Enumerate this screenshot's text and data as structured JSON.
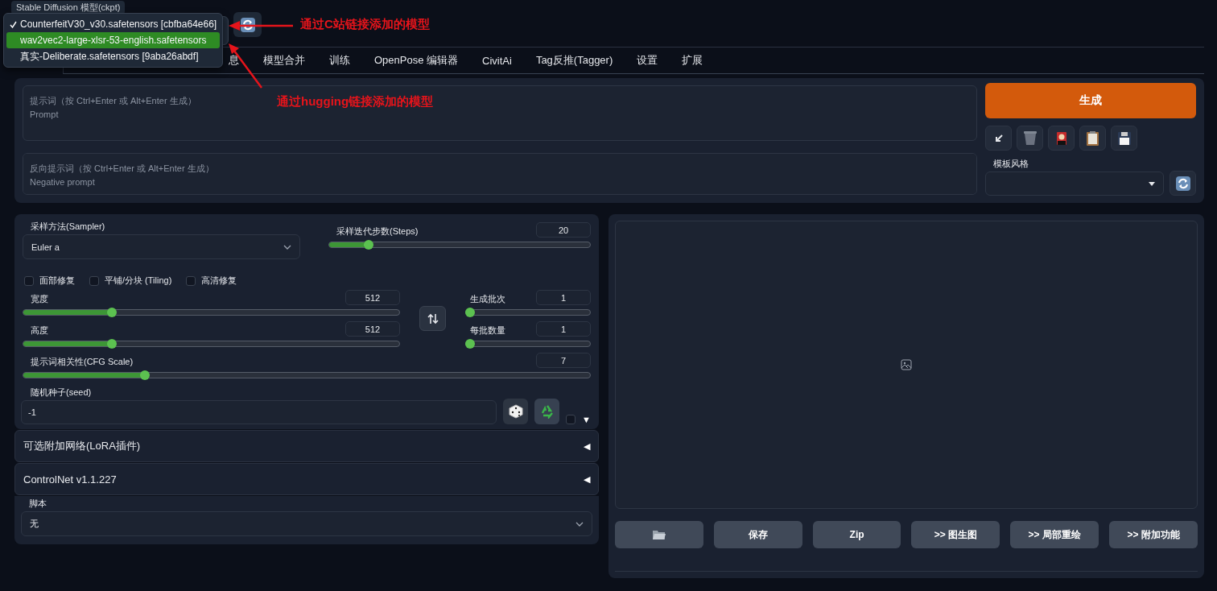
{
  "model_select": {
    "label": "Stable Diffusion 模型(ckpt)",
    "options": [
      {
        "label": "CounterfeitV30_v30.safetensors [cbfba64e66]",
        "checked": true,
        "highlighted": false
      },
      {
        "label": "wav2vec2-large-xlsr-53-english.safetensors",
        "checked": false,
        "highlighted": true
      },
      {
        "label": "真实-Deliberate.safetensors [9aba26abdf]",
        "checked": false,
        "highlighted": false
      }
    ]
  },
  "tabs": [
    {
      "label": "息",
      "selected": false
    },
    {
      "label": "模型合并",
      "selected": false
    },
    {
      "label": "训练",
      "selected": false
    },
    {
      "label": "OpenPose 编辑器",
      "selected": false
    },
    {
      "label": "CivitAi",
      "selected": false
    },
    {
      "label": "Tag反推(Tagger)",
      "selected": false
    },
    {
      "label": "设置",
      "selected": false
    },
    {
      "label": "扩展",
      "selected": false
    }
  ],
  "annotations": [
    {
      "text": "通过C站链接添加的模型"
    },
    {
      "text": "通过hugging链接添加的模型"
    }
  ],
  "prompt": {
    "placeholder": "提示词（按 Ctrl+Enter 或 Alt+Enter 生成）\nPrompt"
  },
  "negative_prompt": {
    "placeholder": "反向提示词（按 Ctrl+Enter 或 Alt+Enter 生成）\nNegative prompt"
  },
  "generate_button": "生成",
  "style_select": {
    "label": "模板风格"
  },
  "sampler": {
    "label": "采样方法(Sampler)",
    "value": "Euler a"
  },
  "steps": {
    "label": "采样迭代步数(Steps)",
    "value": "20",
    "level": 0.14
  },
  "checkboxes": [
    {
      "label": "面部修复",
      "checked": false
    },
    {
      "label": "平铺/分块 (Tiling)",
      "checked": false
    },
    {
      "label": "高清修复",
      "checked": false
    }
  ],
  "size_sliders": [
    {
      "label": "宽度",
      "value": "512",
      "level": 0.23
    },
    {
      "label": "高度",
      "value": "512",
      "level": 0.23
    }
  ],
  "batch_sliders": [
    {
      "label": "生成批次",
      "value": "1",
      "level": 0
    },
    {
      "label": "每批数量",
      "value": "1",
      "level": 0
    }
  ],
  "cfg_scale": {
    "label": "提示词相关性(CFG Scale)",
    "value": "7",
    "level": 0.21
  },
  "seed": {
    "label": "随机种子(seed)",
    "value": "-1",
    "extra_checked": false,
    "toggle": "▼"
  },
  "accordions": [
    {
      "label": "可选附加网络(LoRA插件)",
      "toggle": "◀"
    },
    {
      "label": "ControlNet v1.1.227",
      "toggle": "◀"
    }
  ],
  "script": {
    "label": "脚本",
    "value": "无"
  },
  "output_buttons": [
    {
      "kind": "folder"
    },
    {
      "kind": "text",
      "label": "保存"
    },
    {
      "kind": "text",
      "label": "Zip"
    },
    {
      "kind": "text",
      "label": ">> 图生图"
    },
    {
      "kind": "text",
      "label": ">> 局部重绘"
    },
    {
      "kind": "text",
      "label": ">> 附加功能"
    }
  ]
}
